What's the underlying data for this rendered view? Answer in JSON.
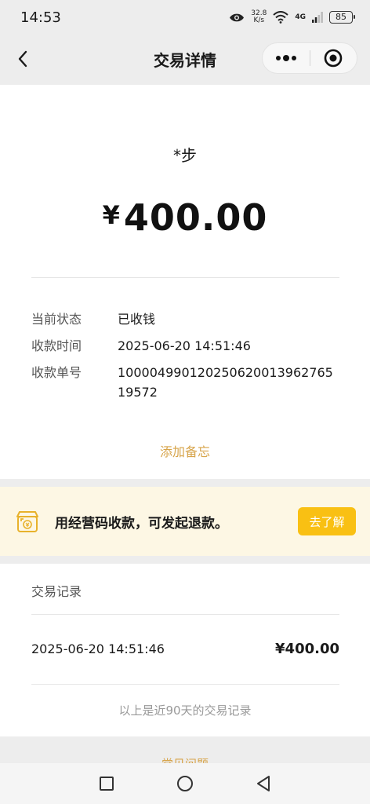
{
  "status_bar": {
    "time": "14:53",
    "net_speed_value": "32.8",
    "net_speed_unit": "K/s",
    "network_type": "4G",
    "battery": "85",
    "icons": [
      "eye-icon",
      "wifi-icon",
      "signal-icon",
      "battery-icon"
    ]
  },
  "nav": {
    "title": "交易详情",
    "back_icon": "chevron-left-icon",
    "more_icon": "more-dots-icon",
    "close_icon": "target-circle-icon"
  },
  "transaction": {
    "payee": "*步",
    "currency_symbol": "¥",
    "amount": "400.00",
    "details": [
      {
        "label": "当前状态",
        "value": "已收钱"
      },
      {
        "label": "收款时间",
        "value": "2025-06-20 14:51:46"
      },
      {
        "label": "收款单号",
        "value": "100004990120250620013962765l9572"
      }
    ],
    "add_note": "添加备忘"
  },
  "banner": {
    "icon": "shop-qr-icon",
    "text": "用经营码收款，可发起退款。",
    "button": "去了解"
  },
  "records": {
    "title": "交易记录",
    "items": [
      {
        "time": "2025-06-20 14:51:46",
        "amount": "¥400.00"
      }
    ],
    "note": "以上是近90天的交易记录"
  },
  "peek": {
    "text": "常见问题"
  },
  "system_nav": {
    "icons": [
      "square-icon",
      "circle-icon",
      "triangle-back-icon"
    ]
  },
  "colors": {
    "accent_gold": "#d7a44a",
    "banner_button": "#f9c013",
    "banner_bg": "#fdf7e4",
    "page_bg": "#ededed"
  }
}
